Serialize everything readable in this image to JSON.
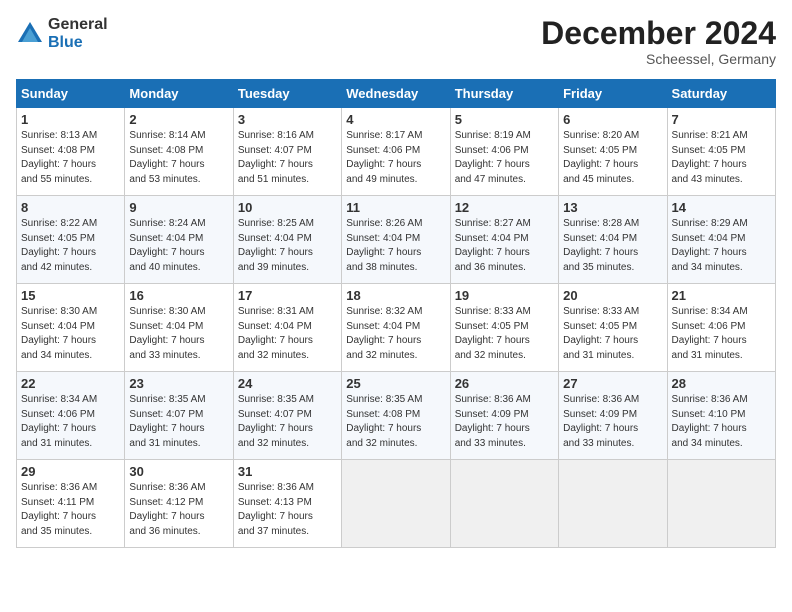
{
  "header": {
    "logo_line1": "General",
    "logo_line2": "Blue",
    "month_year": "December 2024",
    "location": "Scheessel, Germany"
  },
  "weekdays": [
    "Sunday",
    "Monday",
    "Tuesday",
    "Wednesday",
    "Thursday",
    "Friday",
    "Saturday"
  ],
  "weeks": [
    [
      {
        "day": "1",
        "info": "Sunrise: 8:13 AM\nSunset: 4:08 PM\nDaylight: 7 hours\nand 55 minutes."
      },
      {
        "day": "2",
        "info": "Sunrise: 8:14 AM\nSunset: 4:08 PM\nDaylight: 7 hours\nand 53 minutes."
      },
      {
        "day": "3",
        "info": "Sunrise: 8:16 AM\nSunset: 4:07 PM\nDaylight: 7 hours\nand 51 minutes."
      },
      {
        "day": "4",
        "info": "Sunrise: 8:17 AM\nSunset: 4:06 PM\nDaylight: 7 hours\nand 49 minutes."
      },
      {
        "day": "5",
        "info": "Sunrise: 8:19 AM\nSunset: 4:06 PM\nDaylight: 7 hours\nand 47 minutes."
      },
      {
        "day": "6",
        "info": "Sunrise: 8:20 AM\nSunset: 4:05 PM\nDaylight: 7 hours\nand 45 minutes."
      },
      {
        "day": "7",
        "info": "Sunrise: 8:21 AM\nSunset: 4:05 PM\nDaylight: 7 hours\nand 43 minutes."
      }
    ],
    [
      {
        "day": "8",
        "info": "Sunrise: 8:22 AM\nSunset: 4:05 PM\nDaylight: 7 hours\nand 42 minutes."
      },
      {
        "day": "9",
        "info": "Sunrise: 8:24 AM\nSunset: 4:04 PM\nDaylight: 7 hours\nand 40 minutes."
      },
      {
        "day": "10",
        "info": "Sunrise: 8:25 AM\nSunset: 4:04 PM\nDaylight: 7 hours\nand 39 minutes."
      },
      {
        "day": "11",
        "info": "Sunrise: 8:26 AM\nSunset: 4:04 PM\nDaylight: 7 hours\nand 38 minutes."
      },
      {
        "day": "12",
        "info": "Sunrise: 8:27 AM\nSunset: 4:04 PM\nDaylight: 7 hours\nand 36 minutes."
      },
      {
        "day": "13",
        "info": "Sunrise: 8:28 AM\nSunset: 4:04 PM\nDaylight: 7 hours\nand 35 minutes."
      },
      {
        "day": "14",
        "info": "Sunrise: 8:29 AM\nSunset: 4:04 PM\nDaylight: 7 hours\nand 34 minutes."
      }
    ],
    [
      {
        "day": "15",
        "info": "Sunrise: 8:30 AM\nSunset: 4:04 PM\nDaylight: 7 hours\nand 34 minutes."
      },
      {
        "day": "16",
        "info": "Sunrise: 8:30 AM\nSunset: 4:04 PM\nDaylight: 7 hours\nand 33 minutes."
      },
      {
        "day": "17",
        "info": "Sunrise: 8:31 AM\nSunset: 4:04 PM\nDaylight: 7 hours\nand 32 minutes."
      },
      {
        "day": "18",
        "info": "Sunrise: 8:32 AM\nSunset: 4:04 PM\nDaylight: 7 hours\nand 32 minutes."
      },
      {
        "day": "19",
        "info": "Sunrise: 8:33 AM\nSunset: 4:05 PM\nDaylight: 7 hours\nand 32 minutes."
      },
      {
        "day": "20",
        "info": "Sunrise: 8:33 AM\nSunset: 4:05 PM\nDaylight: 7 hours\nand 31 minutes."
      },
      {
        "day": "21",
        "info": "Sunrise: 8:34 AM\nSunset: 4:06 PM\nDaylight: 7 hours\nand 31 minutes."
      }
    ],
    [
      {
        "day": "22",
        "info": "Sunrise: 8:34 AM\nSunset: 4:06 PM\nDaylight: 7 hours\nand 31 minutes."
      },
      {
        "day": "23",
        "info": "Sunrise: 8:35 AM\nSunset: 4:07 PM\nDaylight: 7 hours\nand 31 minutes."
      },
      {
        "day": "24",
        "info": "Sunrise: 8:35 AM\nSunset: 4:07 PM\nDaylight: 7 hours\nand 32 minutes."
      },
      {
        "day": "25",
        "info": "Sunrise: 8:35 AM\nSunset: 4:08 PM\nDaylight: 7 hours\nand 32 minutes."
      },
      {
        "day": "26",
        "info": "Sunrise: 8:36 AM\nSunset: 4:09 PM\nDaylight: 7 hours\nand 33 minutes."
      },
      {
        "day": "27",
        "info": "Sunrise: 8:36 AM\nSunset: 4:09 PM\nDaylight: 7 hours\nand 33 minutes."
      },
      {
        "day": "28",
        "info": "Sunrise: 8:36 AM\nSunset: 4:10 PM\nDaylight: 7 hours\nand 34 minutes."
      }
    ],
    [
      {
        "day": "29",
        "info": "Sunrise: 8:36 AM\nSunset: 4:11 PM\nDaylight: 7 hours\nand 35 minutes."
      },
      {
        "day": "30",
        "info": "Sunrise: 8:36 AM\nSunset: 4:12 PM\nDaylight: 7 hours\nand 36 minutes."
      },
      {
        "day": "31",
        "info": "Sunrise: 8:36 AM\nSunset: 4:13 PM\nDaylight: 7 hours\nand 37 minutes."
      },
      {
        "day": "",
        "info": ""
      },
      {
        "day": "",
        "info": ""
      },
      {
        "day": "",
        "info": ""
      },
      {
        "day": "",
        "info": ""
      }
    ]
  ]
}
